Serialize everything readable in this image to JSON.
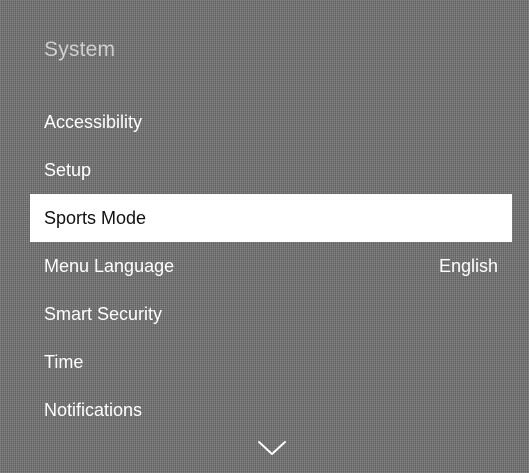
{
  "menu": {
    "title": "System",
    "items": [
      {
        "label": "Accessibility",
        "value": ""
      },
      {
        "label": "Setup",
        "value": ""
      },
      {
        "label": "Sports Mode",
        "value": "",
        "selected": true
      },
      {
        "label": "Menu Language",
        "value": "English"
      },
      {
        "label": "Smart Security",
        "value": ""
      },
      {
        "label": "Time",
        "value": ""
      },
      {
        "label": "Notifications",
        "value": ""
      }
    ],
    "scroll_icon": "chevron-down-icon"
  },
  "colors": {
    "background": "#6f6f6f",
    "selected_background": "#ffffff",
    "selected_text": "#111111",
    "text": "#ffffff",
    "title_text": "#cfcfcf"
  }
}
